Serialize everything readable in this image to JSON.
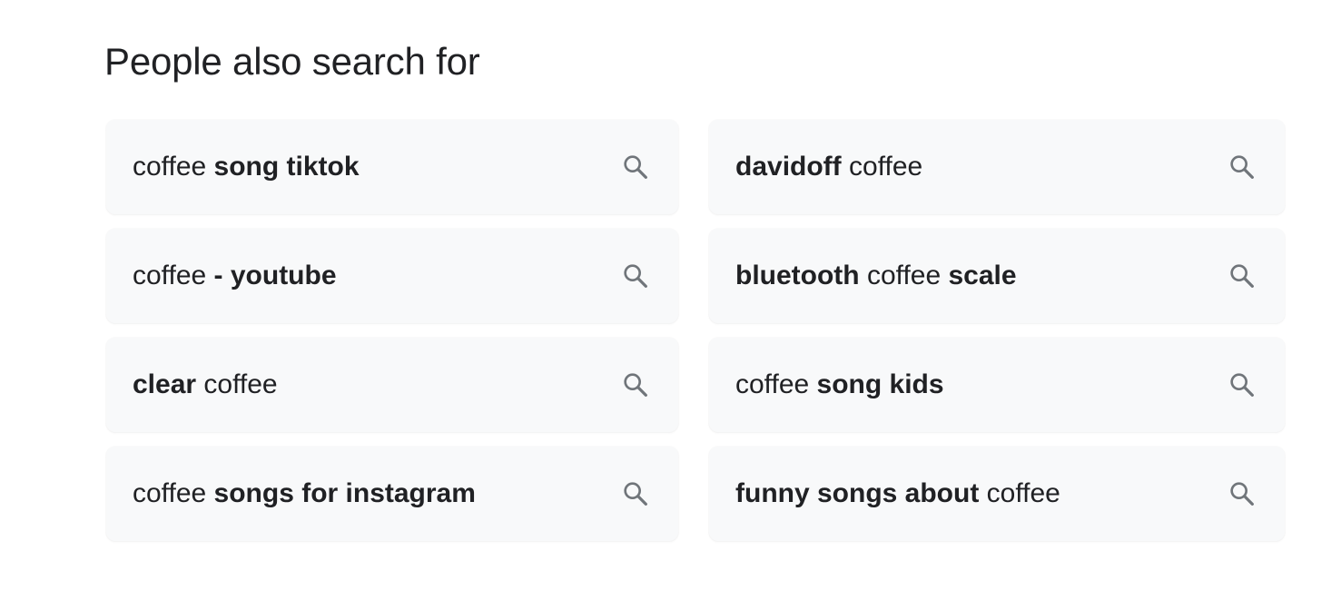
{
  "section": {
    "title": "People also search for"
  },
  "suggestions": [
    {
      "segments": [
        {
          "text": "coffee ",
          "bold": false
        },
        {
          "text": "song tiktok",
          "bold": true
        }
      ],
      "icon": "search-icon"
    },
    {
      "segments": [
        {
          "text": "davidoff",
          "bold": true
        },
        {
          "text": " coffee",
          "bold": false
        }
      ],
      "icon": "search-icon"
    },
    {
      "segments": [
        {
          "text": "coffee ",
          "bold": false
        },
        {
          "text": "- youtube",
          "bold": true
        }
      ],
      "icon": "search-icon"
    },
    {
      "segments": [
        {
          "text": "bluetooth",
          "bold": true
        },
        {
          "text": " coffee ",
          "bold": false
        },
        {
          "text": "scale",
          "bold": true
        }
      ],
      "icon": "search-icon"
    },
    {
      "segments": [
        {
          "text": "clear",
          "bold": true
        },
        {
          "text": " coffee",
          "bold": false
        }
      ],
      "icon": "search-icon"
    },
    {
      "segments": [
        {
          "text": "coffee ",
          "bold": false
        },
        {
          "text": "song kids",
          "bold": true
        }
      ],
      "icon": "search-icon"
    },
    {
      "segments": [
        {
          "text": "coffee ",
          "bold": false
        },
        {
          "text": "songs for instagram",
          "bold": true
        }
      ],
      "icon": "search-icon"
    },
    {
      "segments": [
        {
          "text": "funny songs about",
          "bold": true
        },
        {
          "text": " coffee",
          "bold": false
        }
      ],
      "icon": "search-icon"
    }
  ],
  "colors": {
    "text": "#202124",
    "chip_background": "#f8f9fa",
    "icon": "#70757a"
  }
}
